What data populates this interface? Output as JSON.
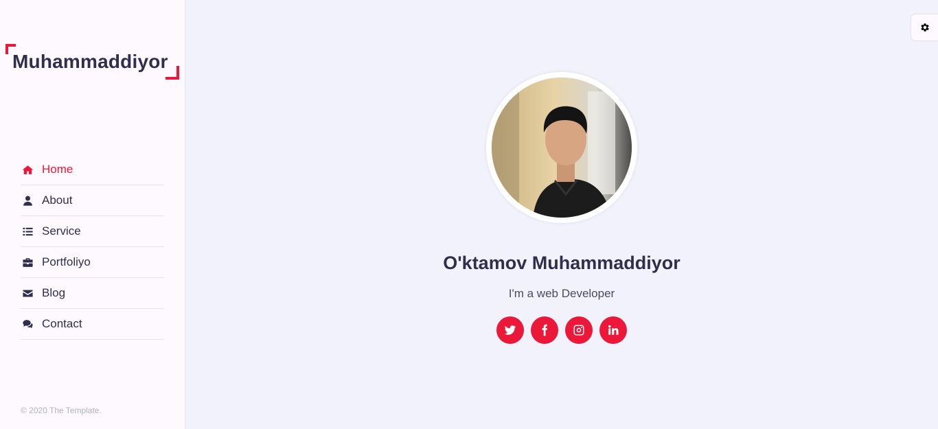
{
  "brand": {
    "logo_text": "Muhammaddiyor"
  },
  "nav": {
    "items": [
      {
        "label": "Home",
        "icon": "home-icon",
        "active": true
      },
      {
        "label": "About",
        "icon": "user-icon"
      },
      {
        "label": "Service",
        "icon": "list-icon"
      },
      {
        "label": "Portfoliyo",
        "icon": "briefcase-icon"
      },
      {
        "label": "Blog",
        "icon": "envelope-icon"
      },
      {
        "label": "Contact",
        "icon": "comments-icon"
      }
    ]
  },
  "footer": {
    "copyright": "© 2020 The Template."
  },
  "settings": {
    "icon": "gear-icon"
  },
  "profile": {
    "name": "O'ktamov Muhammaddiyor",
    "role": "I'm a web Developer",
    "socials": [
      {
        "icon": "twitter-icon"
      },
      {
        "icon": "facebook-icon"
      },
      {
        "icon": "instagram-icon"
      },
      {
        "icon": "linkedin-icon"
      }
    ]
  },
  "colors": {
    "accent": "#ec1839",
    "text": "#302e4d",
    "background": "#f2f2fc",
    "sidebar": "#fdf9ff"
  }
}
